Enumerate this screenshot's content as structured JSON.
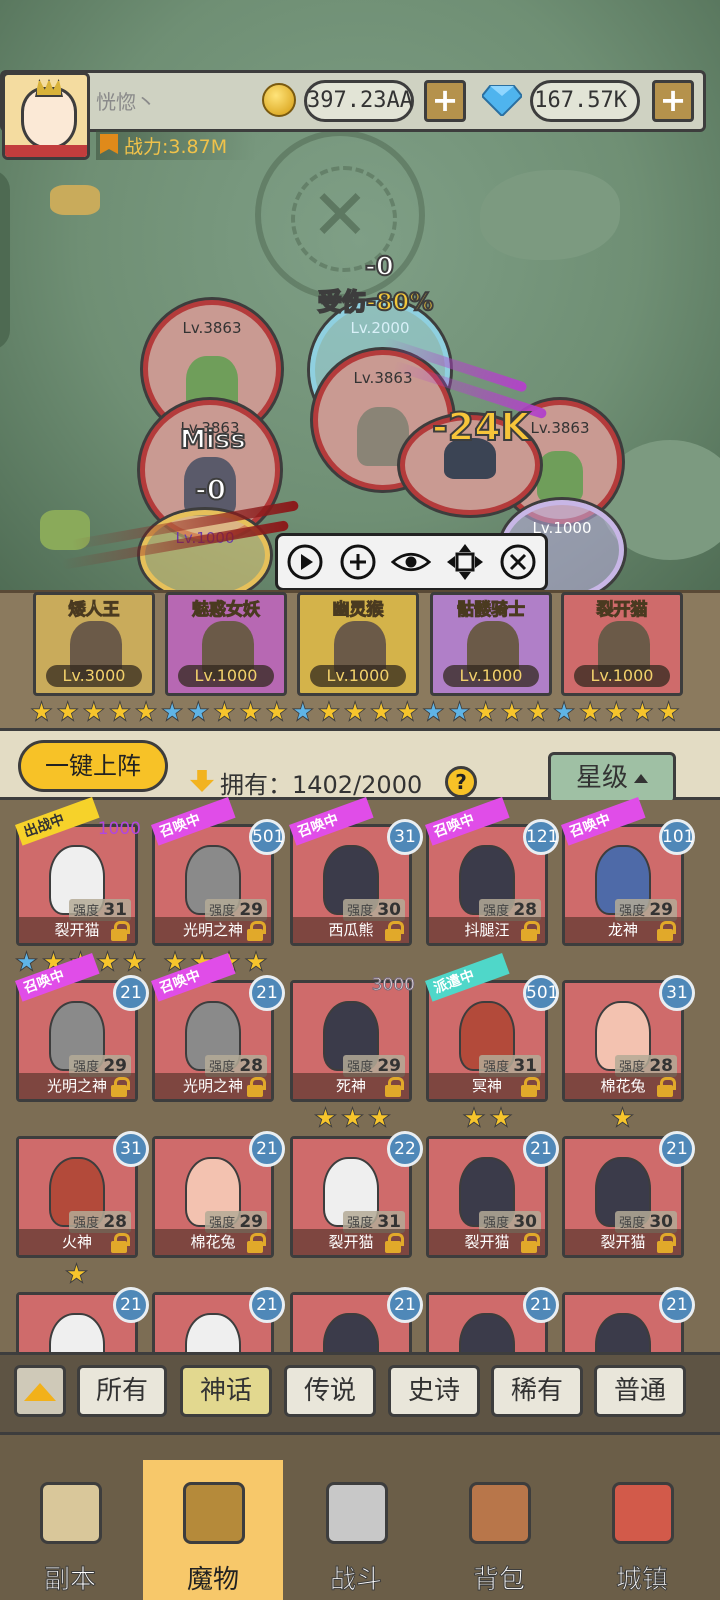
{
  "player": {
    "name": "恍惚丶",
    "power_label": "战力:3.87M",
    "gold": "397.23AA",
    "diamonds": "167.57K"
  },
  "battle": {
    "enemies": [
      {
        "level": "Lv.3863"
      },
      {
        "level": "Lv.3863"
      },
      {
        "level": "Lv.3863"
      },
      {
        "level": "Lv.3863"
      },
      {
        "level": "Lv.3863"
      }
    ],
    "allies": [
      {
        "level": "Lv.2000"
      },
      {
        "level": "Lv.1000"
      },
      {
        "level": "Lv.1000"
      }
    ],
    "fx": {
      "damage_zero": "-0",
      "damage_taken": "受伤-80%",
      "big_damage": "-24K",
      "miss": "Miss",
      "small_zero": "-0"
    }
  },
  "lineup": [
    {
      "name": "矮人王",
      "level": "Lv.3000",
      "color": "#c9ab5b"
    },
    {
      "name": "魅惑女妖",
      "level": "Lv.1000",
      "color": "#b768b3"
    },
    {
      "name": "幽灵猴",
      "level": "Lv.1000",
      "color": "#d4b34a"
    },
    {
      "name": "骷髅骑士",
      "level": "Lv.1000",
      "color": "#b07fc8"
    },
    {
      "name": "裂开猫",
      "level": "Lv.1000",
      "color": "#cf6b6b"
    }
  ],
  "lineup_stars": [
    "gold",
    "gold",
    "gold",
    "gold",
    "gold",
    "blue",
    "blue",
    "gold",
    "gold",
    "gold",
    "blue",
    "gold",
    "gold",
    "gold",
    "gold",
    "blue",
    "blue",
    "gold",
    "gold",
    "gold",
    "blue",
    "gold",
    "gold",
    "gold",
    "gold"
  ],
  "inventory": {
    "deploy_label": "一键上阵",
    "own_label": "拥有：1402/2000",
    "help": "?",
    "sort_label": "星级"
  },
  "status_tags": {
    "summon": "召唤中",
    "battle": "出战中",
    "dispatch": "派遣中"
  },
  "cards": [
    {
      "name": "裂开猫",
      "strength_label": "强度",
      "strength": "31",
      "count": "1000",
      "tag": "battle"
    },
    {
      "name": "光明之神",
      "strength_label": "强度",
      "strength": "29",
      "count": "501",
      "tag": "summon"
    },
    {
      "name": "西瓜熊",
      "strength_label": "强度",
      "strength": "30",
      "count": "31",
      "tag": "summon"
    },
    {
      "name": "抖腿汪",
      "strength_label": "强度",
      "strength": "28",
      "count": "121",
      "tag": "summon"
    },
    {
      "name": "龙神",
      "strength_label": "强度",
      "strength": "29",
      "count": "101",
      "tag": "summon"
    },
    {
      "name": "光明之神",
      "strength_label": "强度",
      "strength": "29",
      "count": "21",
      "tag": "summon"
    },
    {
      "name": "光明之神",
      "strength_label": "强度",
      "strength": "28",
      "count": "21",
      "tag": "summon"
    },
    {
      "name": "死神",
      "strength_label": "强度",
      "strength": "29",
      "count": "3000",
      "tag": ""
    },
    {
      "name": "冥神",
      "strength_label": "强度",
      "strength": "31",
      "count": "501",
      "tag": "dispatch"
    },
    {
      "name": "棉花兔",
      "strength_label": "强度",
      "strength": "28",
      "count": "31",
      "tag": ""
    },
    {
      "name": "火神",
      "strength_label": "强度",
      "strength": "28",
      "count": "31",
      "tag": ""
    },
    {
      "name": "棉花兔",
      "strength_label": "强度",
      "strength": "29",
      "count": "21",
      "tag": ""
    },
    {
      "name": "裂开猫",
      "strength_label": "强度",
      "strength": "31",
      "count": "22",
      "tag": ""
    },
    {
      "name": "裂开猫",
      "strength_label": "强度",
      "strength": "30",
      "count": "21",
      "tag": ""
    },
    {
      "name": "裂开猫",
      "strength_label": "强度",
      "strength": "30",
      "count": "21",
      "tag": ""
    },
    {
      "count": "21"
    },
    {
      "count": "21"
    },
    {
      "count": "21"
    },
    {
      "count": "21"
    },
    {
      "count": "21"
    }
  ],
  "filters": [
    "所有",
    "神话",
    "传说",
    "史诗",
    "稀有",
    "普通"
  ],
  "active_filter": "神话",
  "nav": [
    {
      "label": "副本",
      "icon": "map-icon"
    },
    {
      "label": "魔物",
      "icon": "helmet-icon"
    },
    {
      "label": "战斗",
      "icon": "crossed-swords-icon"
    },
    {
      "label": "背包",
      "icon": "backpack-icon"
    },
    {
      "label": "城镇",
      "icon": "shop-icon"
    }
  ],
  "active_nav": "魔物",
  "colors": {
    "accent": "#f7c227",
    "card_bg": "#cf6b6b",
    "badge": "#4f88b8",
    "summon_tag": "#e04de8",
    "dispatch_tag": "#4fd7c9"
  }
}
